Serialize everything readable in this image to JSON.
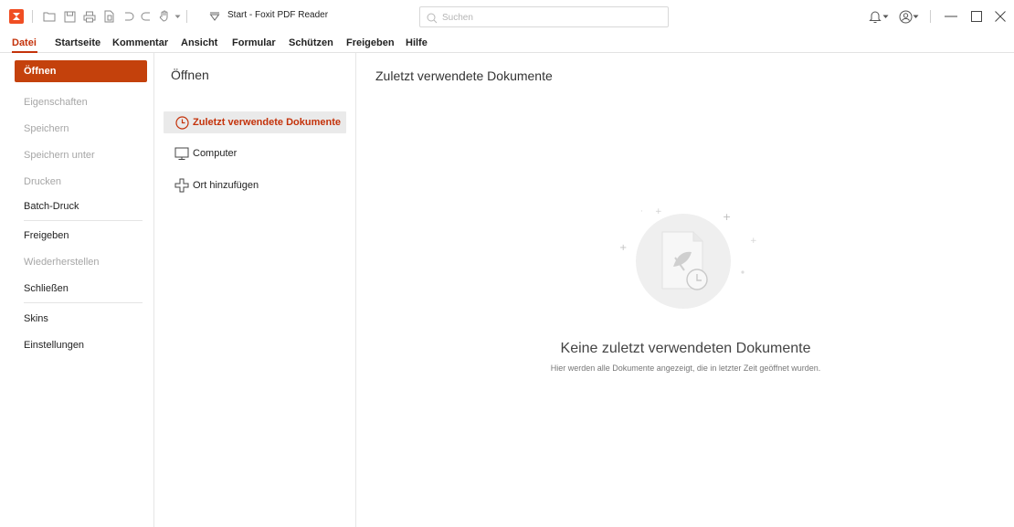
{
  "window": {
    "title": "Start - Foxit PDF Reader"
  },
  "search": {
    "placeholder": "Suchen"
  },
  "colors": {
    "accent": "#c4410c",
    "accent_text": "#c4320a",
    "disabled_text": "#a6a6a6"
  },
  "menu": {
    "items": [
      {
        "label": "Datei",
        "active": true
      },
      {
        "label": "Startseite"
      },
      {
        "label": "Kommentar"
      },
      {
        "label": "Ansicht"
      },
      {
        "label": "Formular"
      },
      {
        "label": "Schützen"
      },
      {
        "label": "Freigeben"
      },
      {
        "label": "Hilfe"
      }
    ]
  },
  "backstage": {
    "open_label": "Öffnen",
    "items": [
      {
        "label": "Eigenschaften",
        "enabled": false
      },
      {
        "label": "Speichern",
        "enabled": false
      },
      {
        "label": "Speichern unter",
        "enabled": false
      },
      {
        "label": "Drucken",
        "enabled": false
      },
      {
        "label": "Batch-Druck",
        "enabled": true
      },
      {
        "label": "Freigeben",
        "enabled": true
      },
      {
        "label": "Wiederherstellen",
        "enabled": false
      },
      {
        "label": "Schließen",
        "enabled": true
      },
      {
        "label": "Skins",
        "enabled": true
      },
      {
        "label": "Einstellungen",
        "enabled": true
      }
    ]
  },
  "open_panel": {
    "title": "Öffnen",
    "locations": [
      {
        "label": "Zuletzt verwendete Dokumente",
        "icon": "clock-icon",
        "selected": true
      },
      {
        "label": "Computer",
        "icon": "monitor-icon",
        "selected": false
      },
      {
        "label": "Ort hinzufügen",
        "icon": "add-location-icon",
        "selected": false
      }
    ]
  },
  "recent": {
    "title": "Zuletzt verwendete Dokumente",
    "empty_title": "Keine zuletzt verwendeten Dokumente",
    "empty_subtitle": "Hier werden alle Dokumente angezeigt, die in letzter Zeit geöffnet wurden."
  }
}
